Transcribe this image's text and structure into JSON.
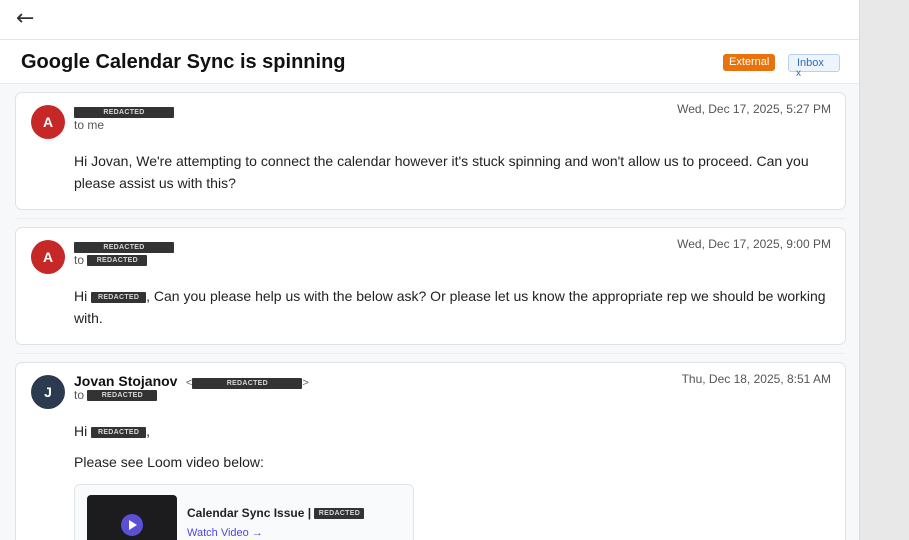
{
  "header": {
    "back_icon": "←"
  },
  "thread": {
    "subject": "Google Calendar Sync is spinning",
    "badges": {
      "external": "External",
      "inbox": "Inbox",
      "inbox_remove": "x"
    }
  },
  "redacted_text": "REDACTED",
  "messages": [
    {
      "avatar_initial": "A",
      "avatar_color": "#c62828",
      "to_label": "to me",
      "date": "Wed, Dec 17, 2025, 5:27 PM",
      "body": "Hi Jovan, We're attempting to connect the calendar however it's stuck spinning and won't allow us to proceed. Can you please assist us with this?"
    },
    {
      "avatar_initial": "A",
      "avatar_color": "#c62828",
      "to_label": "to",
      "date": "Wed, Dec 17, 2025, 9:00 PM",
      "body_prefix": "Hi",
      "body_rest": ", Can you please help us with the below ask? Or please let us know the appropriate rep we should be working with."
    },
    {
      "avatar_initial": "J",
      "avatar_color": "#2b3a4e",
      "sender_name": "Jovan Stojanov",
      "to_label": "to",
      "date": "Thu, Dec 18, 2025, 8:51 AM",
      "greeting_prefix": "Hi",
      "greeting_suffix": ",",
      "body_line": "Please see Loom video below:",
      "loom": {
        "title": "Calendar Sync Issue |",
        "link": "Watch Video →"
      }
    }
  ]
}
